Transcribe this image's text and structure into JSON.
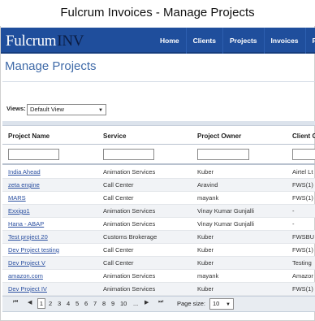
{
  "caption": "Fulcrum Invoices - Manage Projects",
  "logo": {
    "main": "Fulcrum",
    "suffix": "INV"
  },
  "nav": [
    "Home",
    "Clients",
    "Projects",
    "Invoices",
    "Pa"
  ],
  "page_title": "Manage Projects",
  "views": {
    "label": "Views:",
    "selected": "Default View"
  },
  "columns": [
    "Project Name",
    "Service",
    "Project Owner",
    "Client C"
  ],
  "rows": [
    {
      "name": "India Ahead",
      "service": "Animation Services",
      "owner": "Kuber",
      "client": "Airtel Lt"
    },
    {
      "name": "zeta engine",
      "service": "Call Center",
      "owner": "Aravind",
      "client": "FWS(1)"
    },
    {
      "name": "MARS",
      "service": "Call Center",
      "owner": "mayank",
      "client": "FWS(1)"
    },
    {
      "name": "Exxigo1",
      "service": "Animation Services",
      "owner": "Vinay Kumar Gunjalli",
      "client": "-"
    },
    {
      "name": "Hana - ABAP",
      "service": "Animation Services",
      "owner": "Vinay Kumar Gunjalli",
      "client": "-"
    },
    {
      "name": "Test project 20",
      "service": "Customs Brokerage",
      "owner": "Kuber",
      "client": "FWSBU"
    },
    {
      "name": "Dev Project testing",
      "service": "Call Center",
      "owner": "Kuber",
      "client": "FWS(1)"
    },
    {
      "name": "Dev Project V",
      "service": "Call Center",
      "owner": "Kuber",
      "client": "Testing"
    },
    {
      "name": "amazon.com",
      "service": "Animation Services",
      "owner": "mayank",
      "client": "Amazor"
    },
    {
      "name": "Dev Project IV",
      "service": "Animation Services",
      "owner": "Kuber",
      "client": "FWS(1)"
    }
  ],
  "pager": {
    "first_icon": "first-page-icon",
    "prev_icon": "prev-page-icon",
    "current": "1",
    "pages": [
      "2",
      "3",
      "4",
      "5",
      "6",
      "7",
      "8",
      "9",
      "10",
      "..."
    ],
    "next_icon": "next-page-icon",
    "last_icon": "last-page-icon",
    "size_label": "Page size:",
    "size_value": "10"
  }
}
